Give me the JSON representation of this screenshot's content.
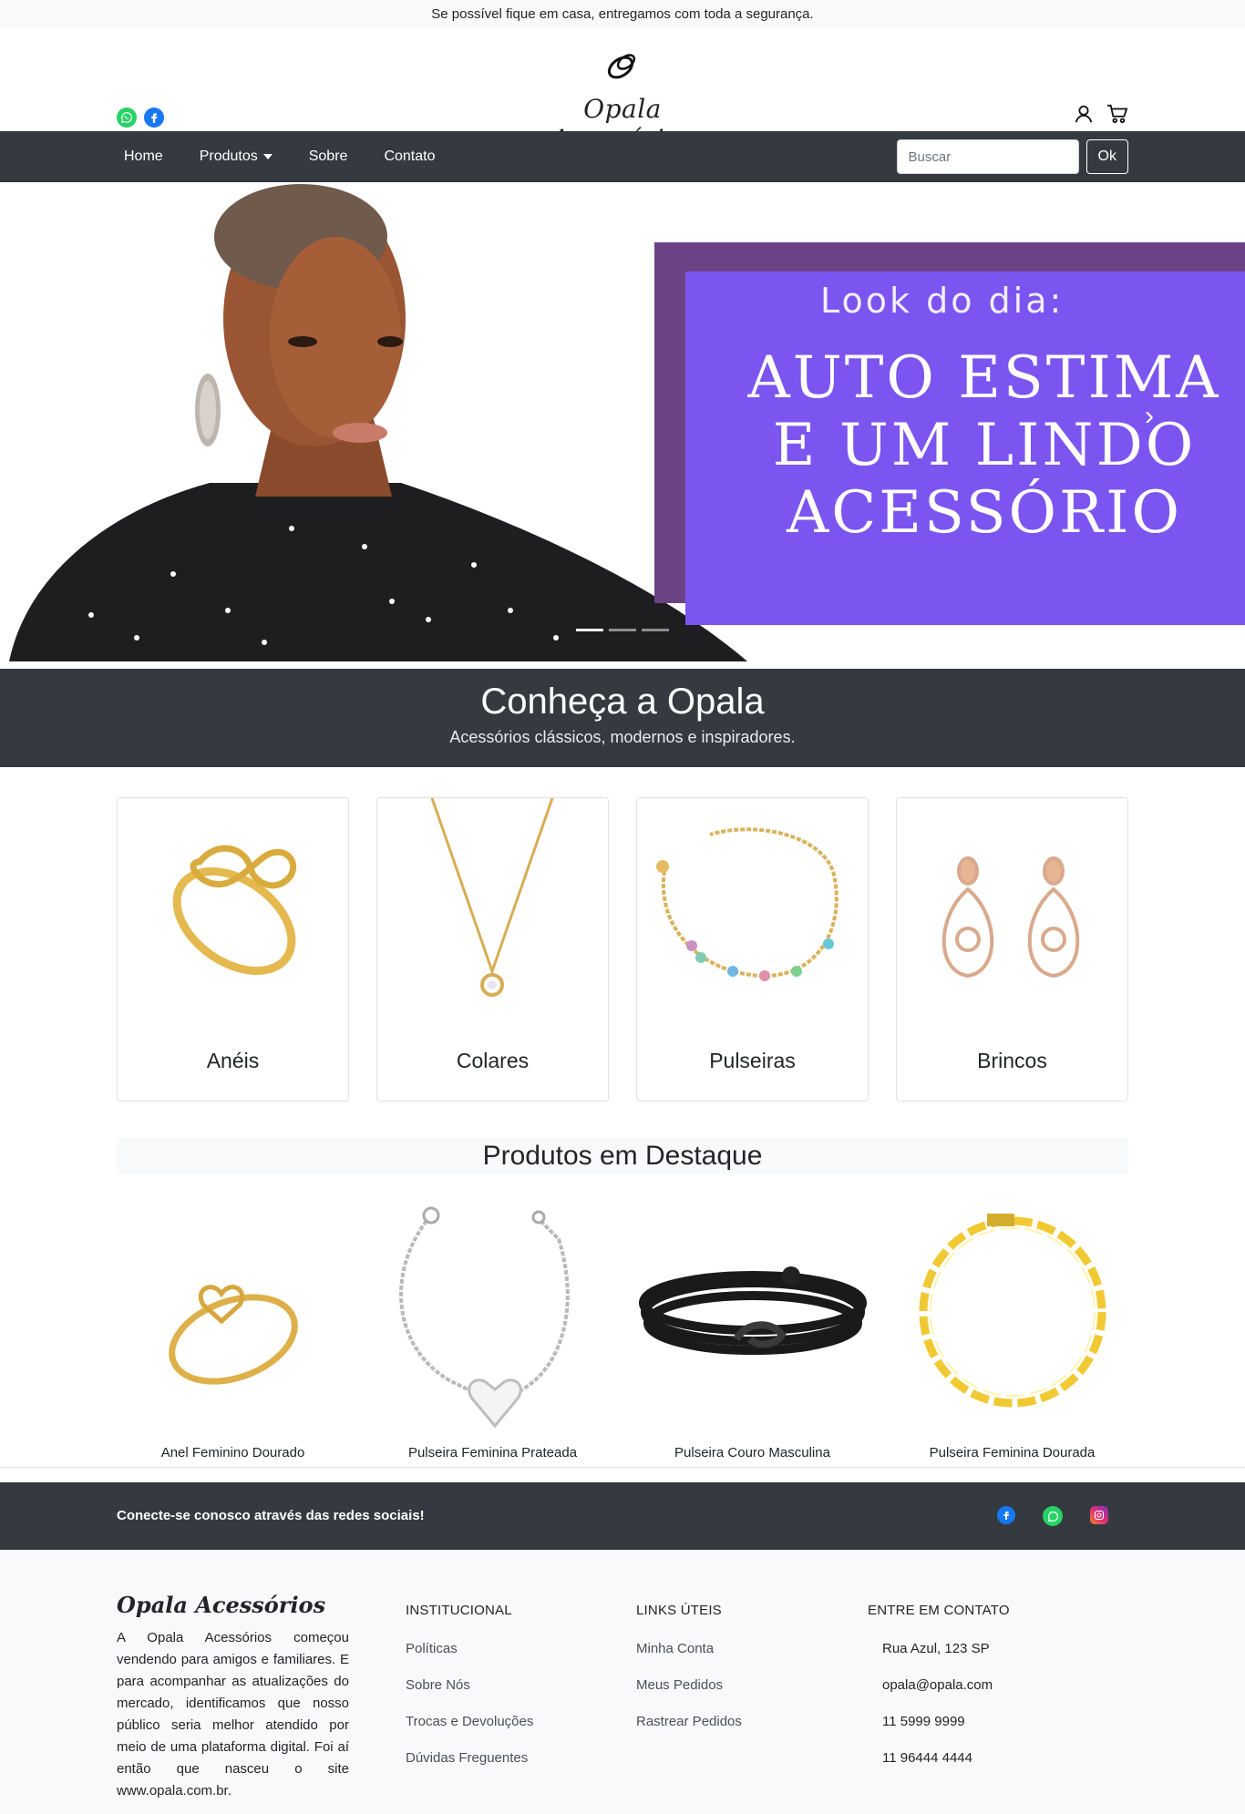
{
  "topbar": {
    "text": "Se possível fique em casa, entregamos com toda a segurança."
  },
  "header": {
    "brand": "Opala Acessórios",
    "social": [
      "whatsapp-icon",
      "facebook-icon"
    ],
    "actions": [
      "user-icon",
      "cart-icon"
    ]
  },
  "nav": {
    "items": [
      {
        "label": "Home"
      },
      {
        "label": "Produtos",
        "dropdown": true
      },
      {
        "label": "Sobre"
      },
      {
        "label": "Contato"
      }
    ],
    "search_placeholder": "Buscar",
    "search_button": "Ok"
  },
  "hero": {
    "look": "Look do dia:",
    "headline_lines": [
      "AUTO ESTIMA",
      "E UM LINDO",
      "ACESSÓRIO"
    ],
    "slides": 3,
    "active_slide": 1,
    "colors": {
      "panel_back": "#6b4384",
      "panel_front": "#7c55f0"
    }
  },
  "intro": {
    "title": "Conheça a Opala",
    "subtitle": "Acessórios clássicos, modernos e inspiradores."
  },
  "categories": [
    {
      "label": "Anéis"
    },
    {
      "label": "Colares"
    },
    {
      "label": "Pulseiras"
    },
    {
      "label": "Brincos"
    }
  ],
  "featured": {
    "title": "Produtos em Destaque",
    "products": [
      {
        "name": "Anel Feminino Dourado"
      },
      {
        "name": "Pulseira Feminina Prateada"
      },
      {
        "name": "Pulseira Couro Masculina"
      },
      {
        "name": "Pulseira Feminina Dourada"
      }
    ]
  },
  "social_bar": {
    "text": "Conecte-se conosco através das redes sociais!",
    "icons": [
      "facebook-icon",
      "whatsapp-icon",
      "instagram-icon"
    ]
  },
  "footer": {
    "brand": "Opala Acessórios",
    "about": "A Opala Acessórios começou vendendo para amigos e familiares. E para acompanhar as atualizações do mercado, identificamos que nosso público seria melhor atendido por meio de uma plataforma digital. Foi aí então que nasceu o site www.opala.com.br.",
    "institucional": {
      "title": "INSTITUCIONAL",
      "links": [
        "Políticas",
        "Sobre Nós",
        "Trocas e Devoluções",
        "Dúvidas Freguentes"
      ]
    },
    "links_uteis": {
      "title": "LINKS ÚTEIS",
      "links": [
        "Minha Conta",
        "Meus Pedidos",
        "Rastrear Pedidos"
      ]
    },
    "contato": {
      "title": "ENTRE EM CONTATO",
      "items": [
        "Rua Azul, 123 SP",
        "opala@opala.com",
        "11 5999 9999",
        "11 96444 4444"
      ]
    }
  }
}
